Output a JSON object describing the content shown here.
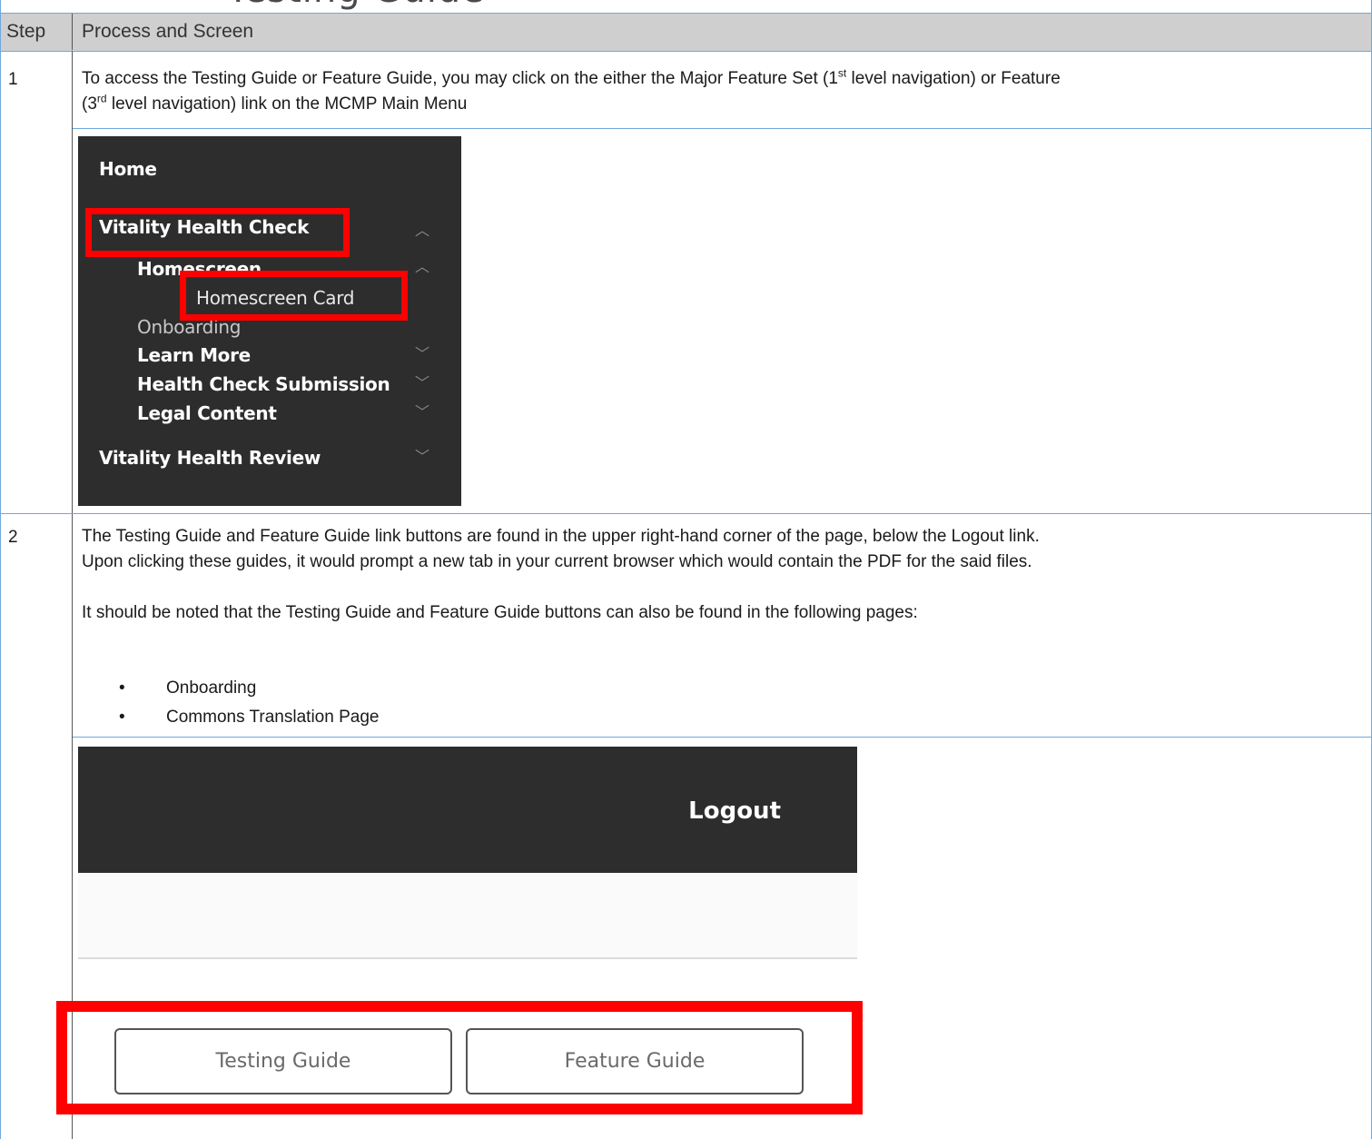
{
  "table": {
    "header_step": "Step",
    "header_process": "Process and Screen"
  },
  "step1": {
    "number": "1",
    "text_a": "To access the Testing Guide or Feature Guide, you may click on the either the Major Feature Set (1",
    "sup_a": "st",
    "text_b": " level navigation) or Feature",
    "text_c": "(3",
    "sup_c": "rd",
    "text_d": " level navigation) link on the MCMP Main Menu",
    "nav": {
      "home": "Home",
      "vhc": "Vitality Health Check",
      "homescreen": "Homescreen",
      "homescreen_card": "Homescreen Card",
      "onboarding": "Onboarding",
      "learn_more": "Learn More",
      "submission": "Health Check Submission",
      "legal": "Legal Content",
      "vhr": "Vitality Health Review"
    }
  },
  "step2": {
    "number": "2",
    "para1_line1": "The Testing Guide and Feature Guide link buttons are found in the upper right-hand corner of the page, below the Logout link.",
    "para1_line2": "Upon clicking these guides, it would prompt a new tab in your current browser which would contain the PDF for the said files.",
    "para2": "It should be noted that the Testing Guide and Feature Guide buttons can also be found in the following pages:",
    "bullets": [
      "Onboarding",
      "Commons Translation Page"
    ],
    "logout": "Logout",
    "testing_guide": "Testing Guide",
    "feature_guide": "Feature Guide"
  }
}
